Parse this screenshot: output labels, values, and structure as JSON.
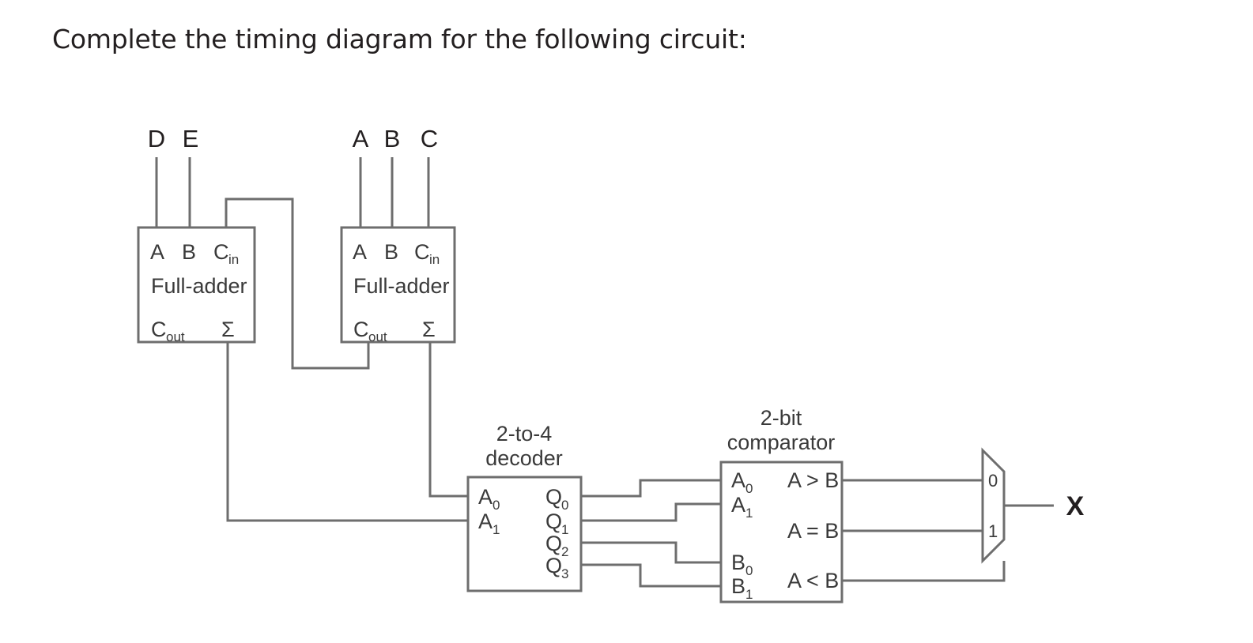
{
  "prompt": "Complete the timing diagram for the following circuit:",
  "colors": {
    "wire": "#6e6e6e",
    "text": "#3a3a3a",
    "prompt_text": "#231f20",
    "background": "#ffffff"
  },
  "circuit": {
    "inputs": [
      {
        "name": "D",
        "label": "D"
      },
      {
        "name": "E",
        "label": "E"
      },
      {
        "name": "A",
        "label": "A"
      },
      {
        "name": "B",
        "label": "B"
      },
      {
        "name": "C",
        "label": "C"
      }
    ],
    "output": {
      "name": "X",
      "label": "X"
    },
    "adder1": {
      "title": "Full-adder",
      "in_a": "A",
      "in_b": "B",
      "in_cin": "C",
      "in_cin_sub": "in",
      "out_cout": "C",
      "out_cout_sub": "out",
      "out_sum": "Σ"
    },
    "adder2": {
      "title": "Full-adder",
      "in_a": "A",
      "in_b": "B",
      "in_cin": "C",
      "in_cin_sub": "in",
      "out_cout": "C",
      "out_cout_sub": "out",
      "out_sum": "Σ"
    },
    "decoder": {
      "title_line1": "2-to-4",
      "title_line2": "decoder",
      "inputs": [
        {
          "base": "A",
          "sub": "0"
        },
        {
          "base": "A",
          "sub": "1"
        }
      ],
      "outputs": [
        {
          "base": "Q",
          "sub": "0"
        },
        {
          "base": "Q",
          "sub": "1"
        },
        {
          "base": "Q",
          "sub": "2"
        },
        {
          "base": "Q",
          "sub": "3"
        }
      ]
    },
    "comparator": {
      "title_line1": "2-bit",
      "title_line2": "comparator",
      "inputs": [
        {
          "base": "A",
          "sub": "0"
        },
        {
          "base": "A",
          "sub": "1"
        },
        {
          "base": "B",
          "sub": "0"
        },
        {
          "base": "B",
          "sub": "1"
        }
      ],
      "outputs": [
        {
          "label": "A > B"
        },
        {
          "label": "A = B"
        },
        {
          "label": "A < B"
        }
      ]
    },
    "mux": {
      "input_0": "0",
      "input_1": "1"
    }
  }
}
